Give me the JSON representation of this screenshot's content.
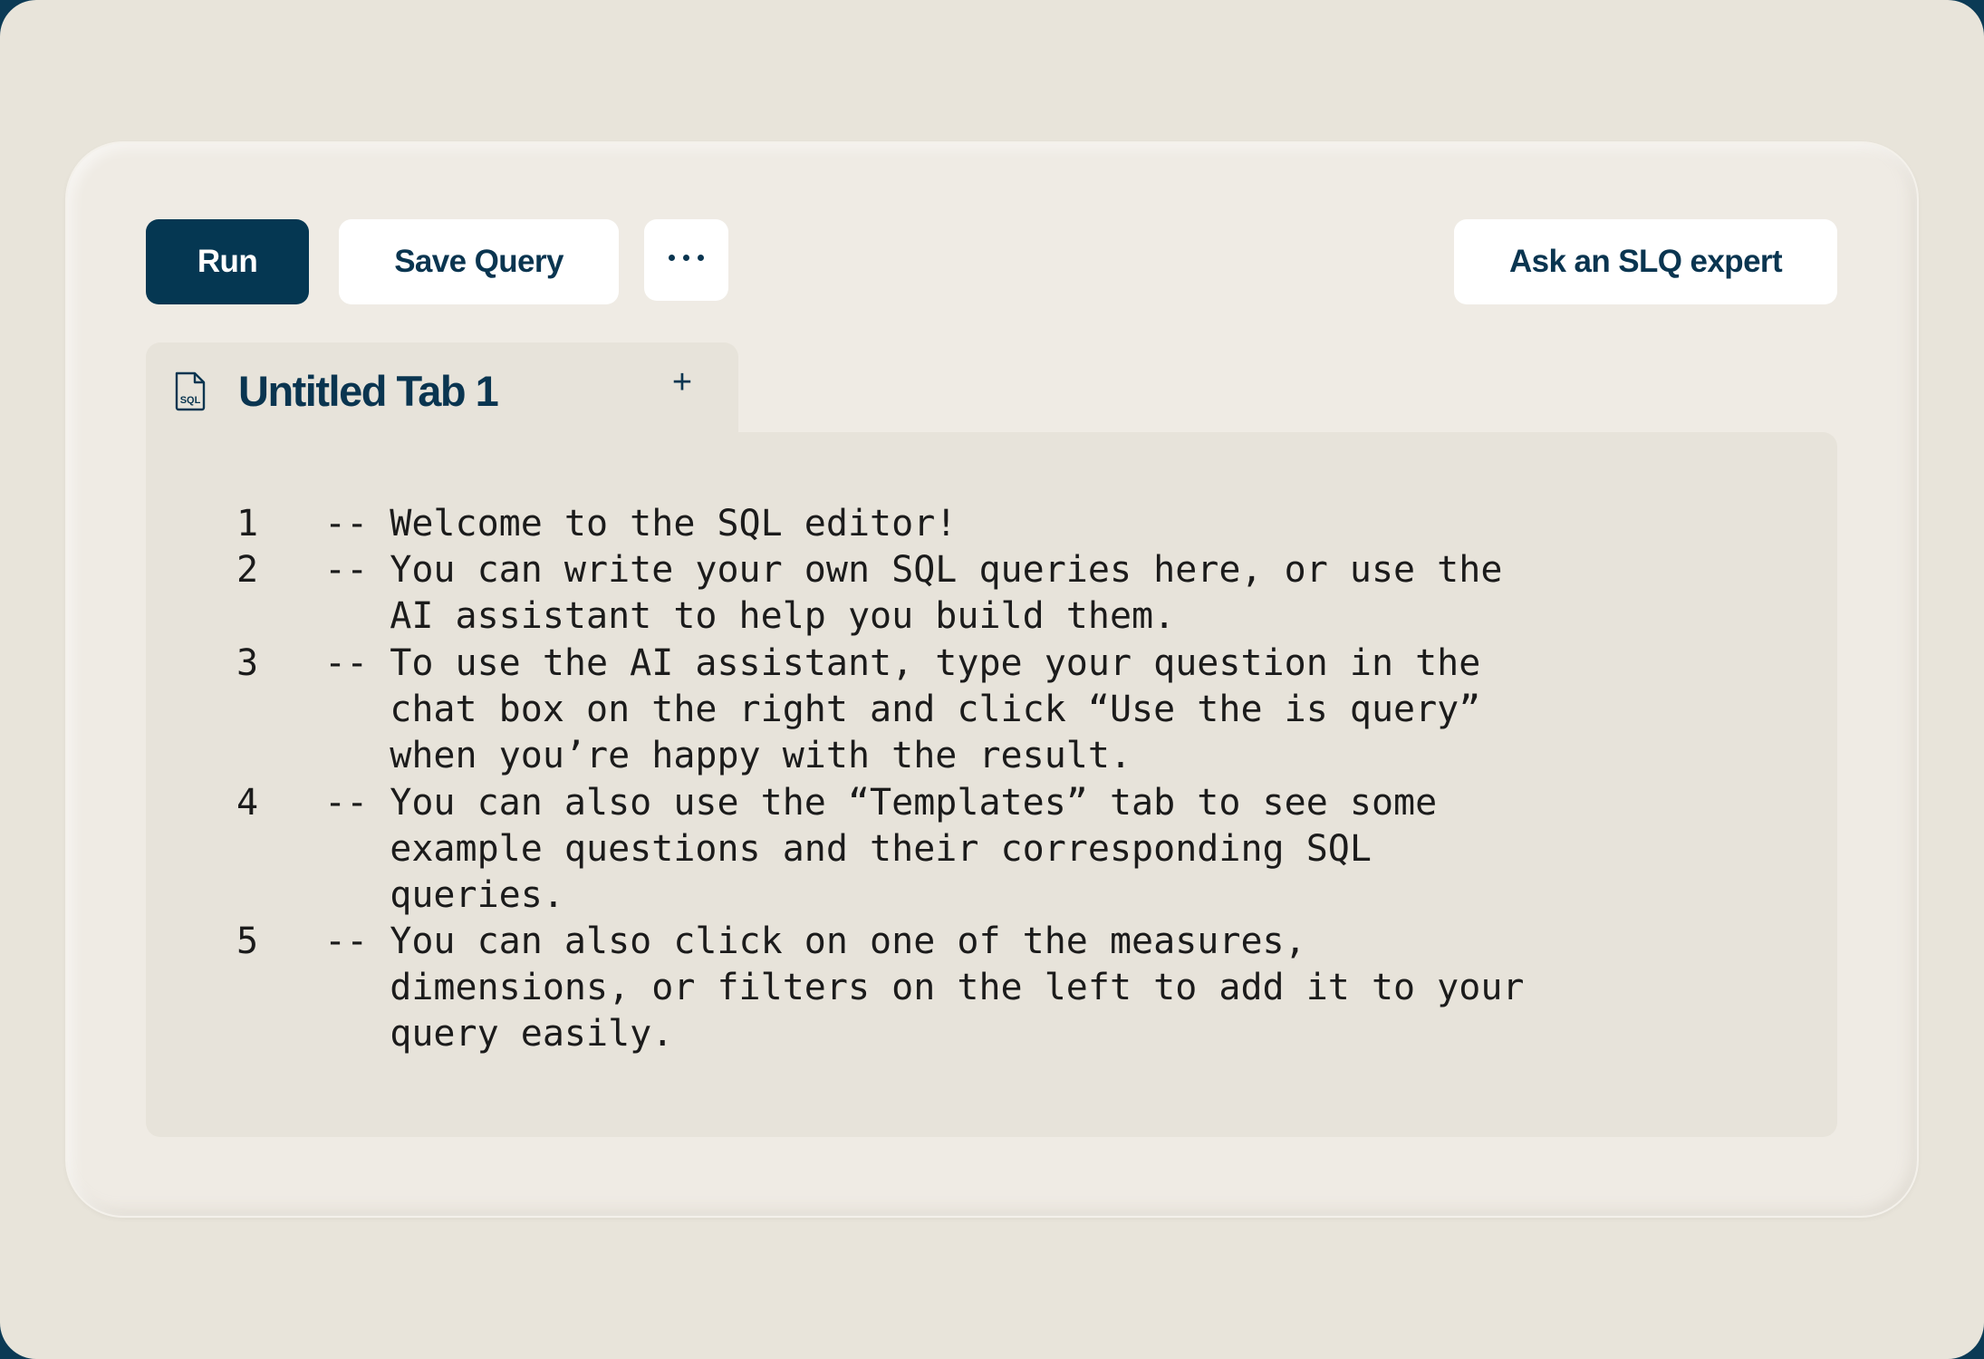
{
  "toolbar": {
    "run_label": "Run",
    "save_label": "Save Query",
    "more_icon": "more-horizontal-icon",
    "expert_label": "Ask an SLQ expert"
  },
  "tabs": [
    {
      "label": "Untitled Tab 1",
      "icon": "sql-file-icon",
      "icon_text": "SQL",
      "add_label": "+"
    }
  ],
  "editor": {
    "lines": [
      {
        "number": "1",
        "text": "-- Welcome to the SQL editor!"
      },
      {
        "number": "2",
        "text": "-- You can write your own SQL queries here, or use the\n   AI assistant to help you build them."
      },
      {
        "number": "3",
        "text": "-- To use the AI assistant, type your question in the\n   chat box on the right and click “Use the is query”\n   when you’re happy with the result."
      },
      {
        "number": "4",
        "text": "-- You can also use the “Templates” tab to see some\n   example questions and their corresponding SQL\n   queries."
      },
      {
        "number": "5",
        "text": "-- You can also click on one of the measures,\n   dimensions, or filters on the left to add it to your\n   query easily."
      }
    ]
  },
  "colors": {
    "primary": "#053752",
    "text": "#0a3550",
    "background": "#e8e4da",
    "editor_bg": "#e7e3da"
  }
}
